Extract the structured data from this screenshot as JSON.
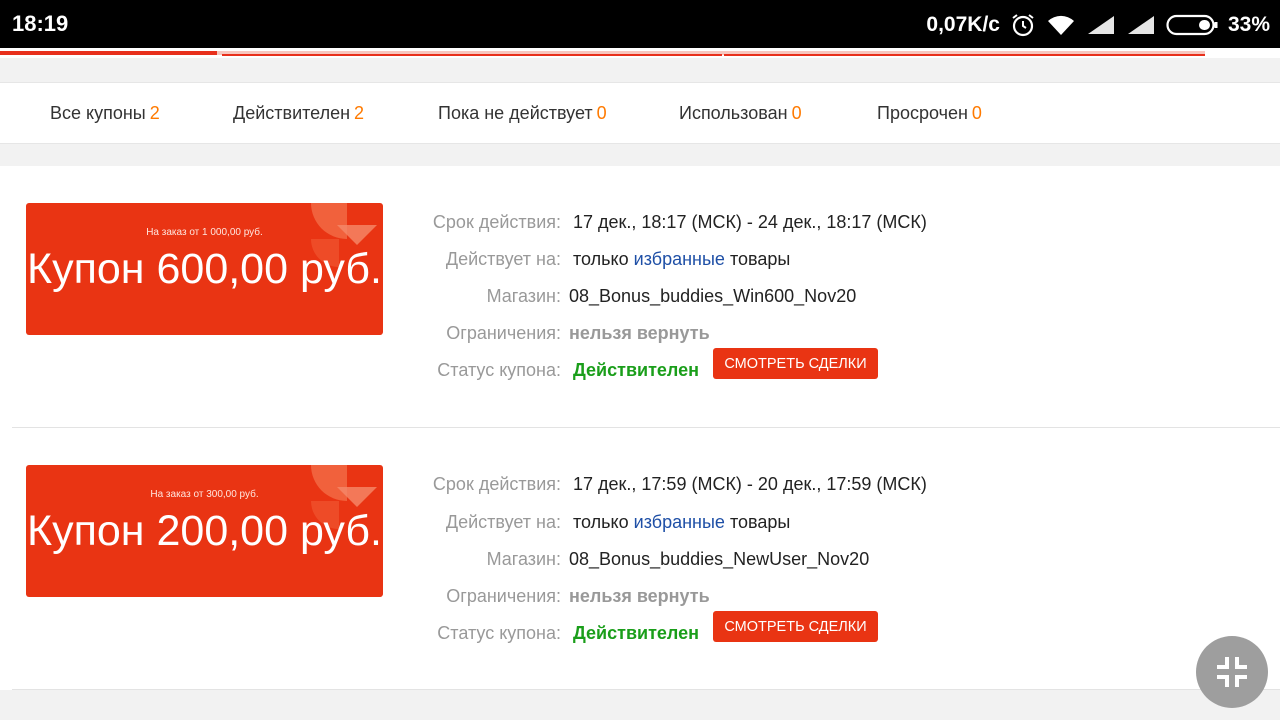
{
  "status_bar": {
    "time": "18:19",
    "speed": "0,07K/c",
    "battery": "33%",
    "icons": [
      "alarm-icon",
      "wifi-icon",
      "signal-icon",
      "signal-icon",
      "battery-icon"
    ]
  },
  "page_load_progress": 0.18,
  "tabs": [
    {
      "label": "Все купоны",
      "count": "2"
    },
    {
      "label": "Действителен",
      "count": "2"
    },
    {
      "label": "Пока не действует",
      "count": "0"
    },
    {
      "label": "Использован",
      "count": "0"
    },
    {
      "label": "Просрочен",
      "count": "0"
    }
  ],
  "labels": {
    "validity": "Срок действия:",
    "applies": "Действует на:",
    "shop": "Магазин:",
    "restrictions": "Ограничения:",
    "status": "Статус купона:"
  },
  "coupons": [
    {
      "min_order": "На заказ от 1 000,00 руб.",
      "amount": "Купон 600,00 руб.",
      "validity": "17 дек., 18:17 (МСК) - 24 дек., 18:17 (МСК)",
      "applies_prefix": "только",
      "applies_link": "избранные",
      "applies_suffix": "товары",
      "shop": "08_Bonus_buddies_Win600_Nov20",
      "restrictions": "нельзя вернуть",
      "status": "Действителен",
      "button": "СМОТРЕТЬ СДЕЛКИ"
    },
    {
      "min_order": "На заказ от 300,00 руб.",
      "amount": "Купон 200,00 руб.",
      "validity": "17 дек., 17:59 (МСК) - 20 дек., 17:59 (МСК)",
      "applies_prefix": "только",
      "applies_link": "избранные",
      "applies_suffix": "товары",
      "shop": "08_Bonus_buddies_NewUser_Nov20",
      "restrictions": "нельзя вернуть",
      "status": "Действителен",
      "button": "СМОТРЕТЬ СДЕЛКИ"
    }
  ],
  "colors": {
    "accent": "#e93413",
    "count": "#ff7a00",
    "status_valid": "#1a9e1a",
    "link": "#1e4fa6"
  },
  "fab_icon": "collapse-icon"
}
